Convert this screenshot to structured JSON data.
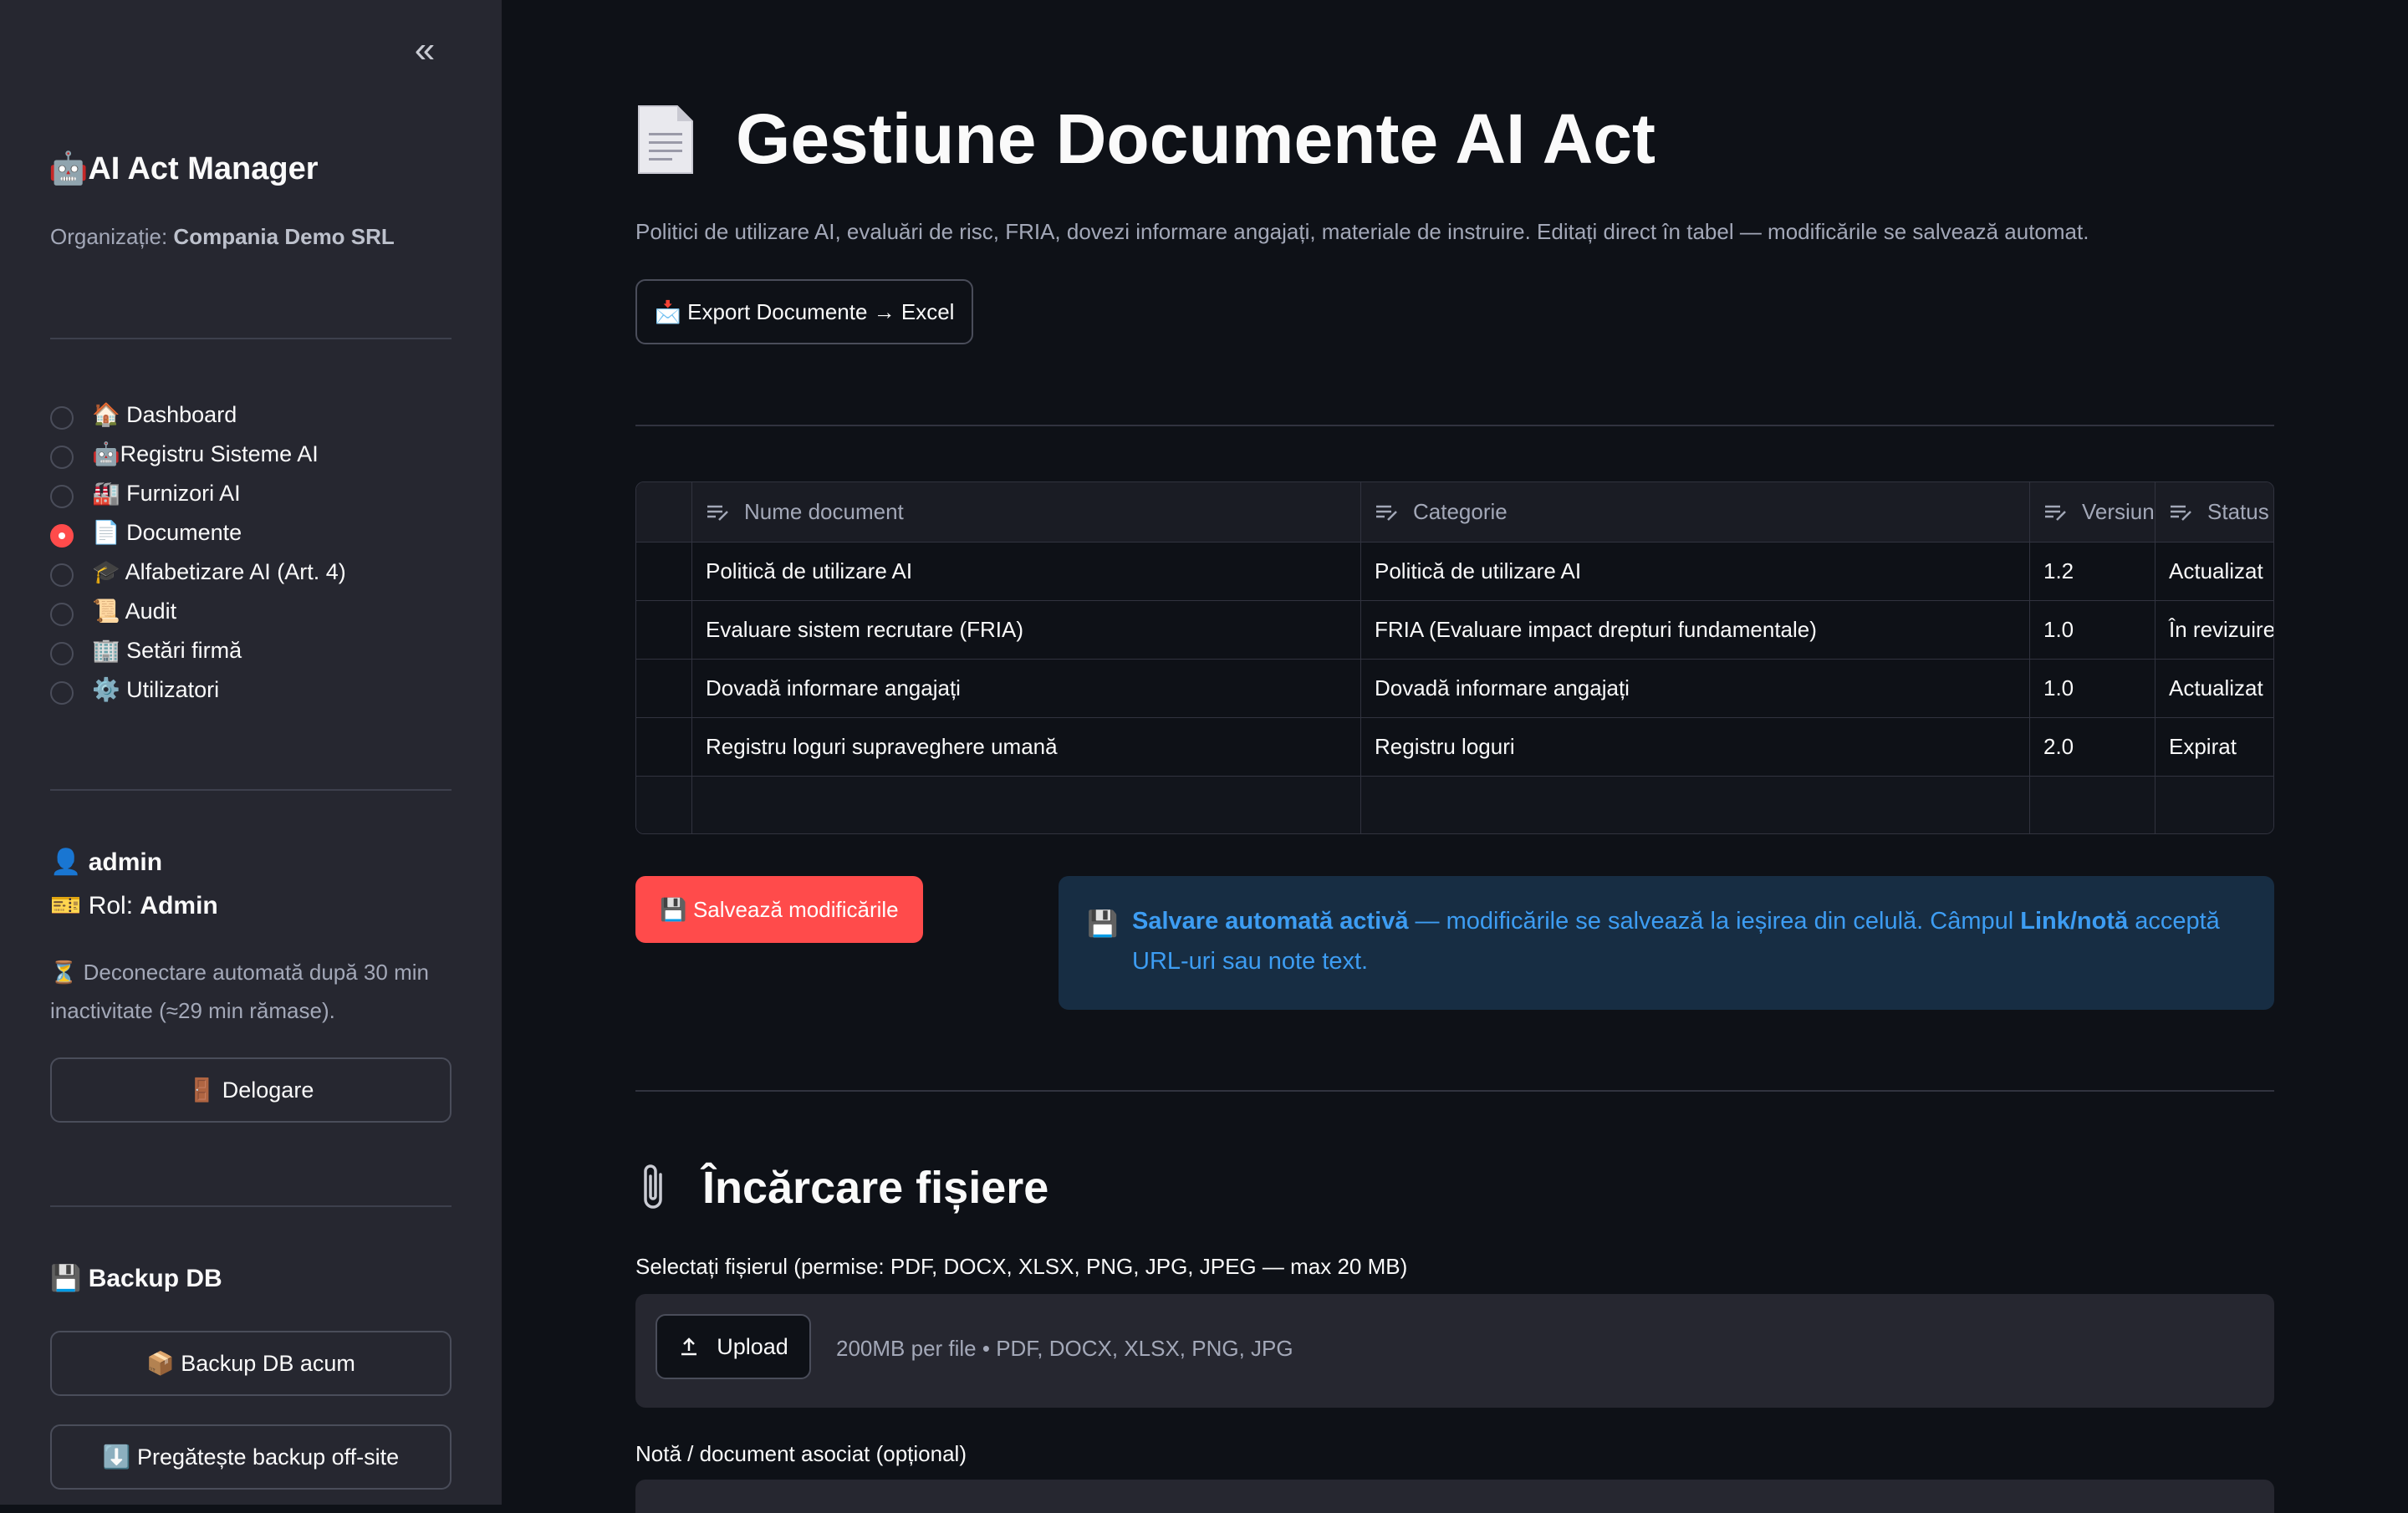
{
  "sidebar": {
    "collapse_glyph": "«",
    "app_title": "🤖AI Act Manager",
    "org_label": "Organizație:",
    "org_name": "Compania Demo SRL",
    "nav": [
      {
        "label": "🏠 Dashboard",
        "selected": false
      },
      {
        "label": "🤖Registru Sisteme AI",
        "selected": false
      },
      {
        "label": "🏭 Furnizori AI",
        "selected": false
      },
      {
        "label": "📄 Documente",
        "selected": true
      },
      {
        "label": "🎓 Alfabetizare AI (Art. 4)",
        "selected": false
      },
      {
        "label": "📜 Audit",
        "selected": false
      },
      {
        "label": "🏢 Setări firmă",
        "selected": false
      },
      {
        "label": "⚙️ Utilizatori",
        "selected": false
      }
    ],
    "user": {
      "icon": "👤",
      "name": "admin",
      "role_icon": "🎫",
      "role_label": "Rol:",
      "role": "Admin"
    },
    "logout_note": "⏳ Deconectare automată după 30 min inactivitate (≈29 min rămase).",
    "logout_button": "🚪 Delogare",
    "backup_title": "💾 Backup DB",
    "backup_now": "📦 Backup DB acum",
    "backup_offsite": "⬇️ Pregătește backup off-site"
  },
  "main": {
    "title": "Gestiune Documente AI Act",
    "subtitle": "Politici de utilizare AI, evaluări de risc, FRIA, dovezi informare angajați, materiale de instruire. Editați direct în tabel — modificările se salvează automat.",
    "export_button": "📩 Export Documente → Excel",
    "table": {
      "columns": [
        "Nume document",
        "Categorie",
        "Versiun",
        "Status"
      ],
      "rows": [
        [
          "Politică de utilizare AI",
          "Politică de utilizare AI",
          "1.2",
          "Actualizat"
        ],
        [
          "Evaluare sistem recrutare (FRIA)",
          "FRIA (Evaluare impact drepturi fundamentale)",
          "1.0",
          "În revizuire"
        ],
        [
          "Dovadă informare angajați",
          "Dovadă informare angajați",
          "1.0",
          "Actualizat"
        ],
        [
          "Registru loguri supraveghere umană",
          "Registru loguri",
          "2.0",
          "Expirat"
        ]
      ]
    },
    "save_button": "💾 Salvează modificările",
    "info": {
      "icon": "💾",
      "bold1": "Salvare automată activă",
      "text1": " — modificările se salvează la ieșirea din celulă. Câmpul ",
      "bold2": "Link/notă",
      "text2": " acceptă URL-uri sau note text."
    },
    "upload_section": {
      "title": "Încărcare fișiere",
      "file_label": "Selectați fișierul (permise: PDF, DOCX, XLSX, PNG, JPG, JPEG — max 20 MB)",
      "upload_button": "Upload",
      "hint": "200MB per file • PDF, DOCX, XLSX, PNG, JPG",
      "note_label": "Notă / document asociat (opțional)"
    }
  }
}
